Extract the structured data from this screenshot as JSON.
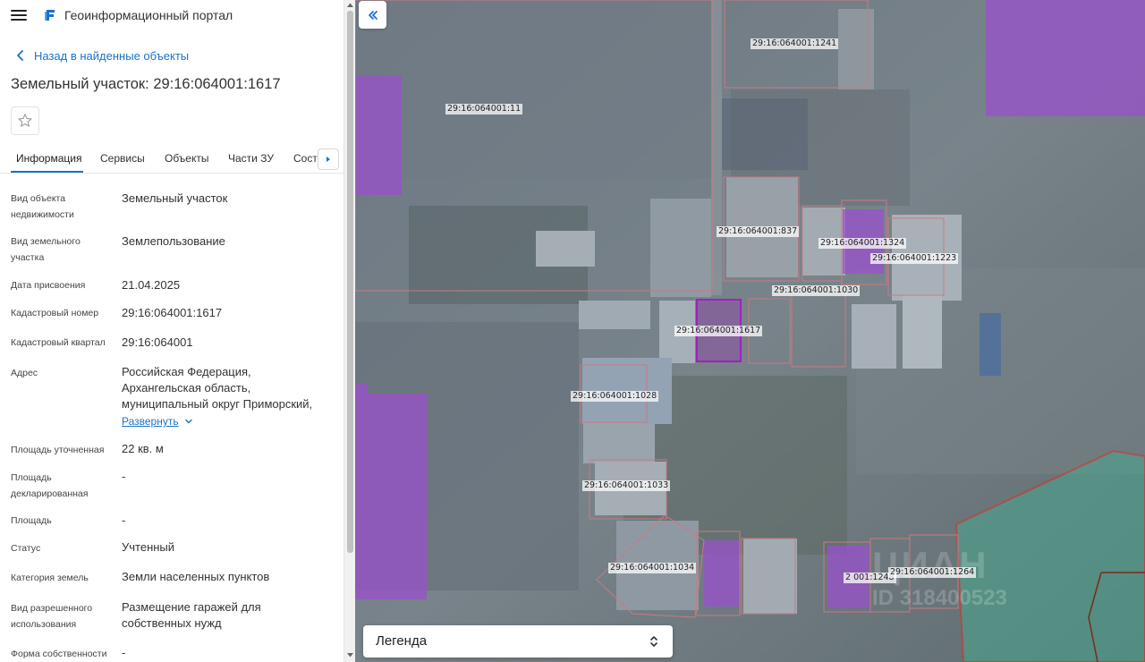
{
  "app": {
    "title": "Геоинформационный портал"
  },
  "nav": {
    "back_label": "Назад в найденные объекты"
  },
  "page": {
    "title": "Земельный участок: 29:16:064001:1617"
  },
  "tabs": [
    {
      "label": "Информация",
      "active": true
    },
    {
      "label": "Сервисы"
    },
    {
      "label": "Объекты"
    },
    {
      "label": "Части ЗУ"
    },
    {
      "label": "Соста"
    }
  ],
  "info": {
    "rows": [
      {
        "label": "Вид объекта недвижимости",
        "value": "Земельный участок"
      },
      {
        "label": "Вид земельного участка",
        "value": "Землепользование"
      },
      {
        "label": "Дата присвоения",
        "value": "21.04.2025"
      },
      {
        "label": "Кадастровый номер",
        "value": "29:16:064001:1617"
      },
      {
        "label": "Кадастровый квартал",
        "value": "29:16:064001"
      },
      {
        "label": "Адрес",
        "value_lines": [
          "Российская Федерация,",
          "Архангельская область,",
          "муниципальный округ Приморский,"
        ]
      },
      {
        "label": "Площадь уточненная",
        "value": "22 кв. м"
      },
      {
        "label": "Площадь декларированная",
        "value": "-"
      },
      {
        "label": "Площадь",
        "value": "-"
      },
      {
        "label": "Статус",
        "value": "Учтенный"
      },
      {
        "label": "Категория земель",
        "value": "Земли населенных пунктов"
      },
      {
        "label": "Вид разрешенного использования",
        "value": "Размещение гаражей для собственных нужд"
      },
      {
        "label": "Форма собственности",
        "value": "-"
      }
    ],
    "expand_label": "Развернуть"
  },
  "map": {
    "labels": [
      "29:16:064001:1241",
      "29:16:064001:11",
      "29:16:064001:837",
      "29:16:064001:1324",
      "29:16:064001:1223",
      "29:16:064001:1030",
      "29:16:064001:1617",
      "29:16:064001:1028",
      "29:16:064001:1033",
      "29:16:064001:1034",
      "2 001:1248",
      "29:16:064001:1264"
    ],
    "watermark": "ЦИАН",
    "watermark_id": "ID 318400523",
    "legend_label": "Легенда"
  },
  "colors": {
    "accent": "#1a73c8",
    "parcel_selected": "#a020c0",
    "parcel_fill": "#9b4fd0",
    "boundary_red": "#e0302a",
    "zone_green": "#4aa890"
  },
  "icons": {
    "menu": "hamburger-icon",
    "logo": "portal-logo-icon",
    "back": "chevron-left-icon",
    "favorite": "star-outline-icon",
    "tab_scroll": "triangle-right-icon",
    "expand": "chevron-down-icon",
    "collapse": "double-chevron-left-icon",
    "legend_toggle": "chevron-up-down-icon"
  }
}
